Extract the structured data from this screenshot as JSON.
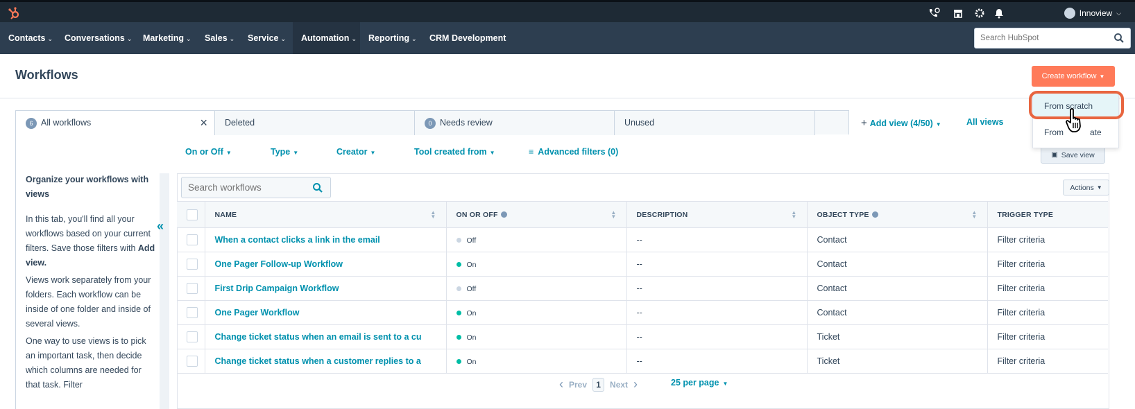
{
  "topbar": {
    "account_name": "Innoview",
    "icons": [
      "hubspot-logo-icon",
      "phone-icon",
      "marketplace-icon",
      "settings-gear-icon",
      "notifications-bell-icon"
    ]
  },
  "nav": {
    "items": [
      {
        "label": "Contacts",
        "has_caret": true
      },
      {
        "label": "Conversations",
        "has_caret": true
      },
      {
        "label": "Marketing",
        "has_caret": true
      },
      {
        "label": "Sales",
        "has_caret": true
      },
      {
        "label": "Service",
        "has_caret": true
      },
      {
        "label": "Automation",
        "has_caret": true,
        "active": true
      },
      {
        "label": "Reporting",
        "has_caret": true
      },
      {
        "label": "CRM Development",
        "has_caret": false
      }
    ],
    "search_placeholder": "Search HubSpot"
  },
  "header": {
    "title": "Workflows",
    "create_button": "Create workflow"
  },
  "create_menu": {
    "options": [
      "From scratch",
      "From template"
    ],
    "visible_options": [
      "From scratch",
      "From"
    ],
    "visible_option_2_tail": "ate"
  },
  "tabs": [
    {
      "label": "All workflows",
      "badge": "6",
      "active": true,
      "closable": true
    },
    {
      "label": "Deleted",
      "badge": null
    },
    {
      "label": "Needs review",
      "badge": "0"
    },
    {
      "label": "Unused",
      "badge": null
    }
  ],
  "tab_actions": {
    "add_view": "Add view (4/50)",
    "all_views": "All views"
  },
  "filters": {
    "on_off": "On or Off",
    "type": "Type",
    "creator": "Creator",
    "tool_created_from": "Tool created from",
    "advanced": "Advanced filters (0)",
    "save_view": "Save view"
  },
  "sidebar": {
    "heading": "Organize your workflows with views",
    "para1_pre": "In this tab, you'll find all your workflows based on your current filters. Save those filters with ",
    "para1_bold": "Add view.",
    "para2": "Views work separately from your folders. Each workflow can be inside of one folder and inside of several views.",
    "para3": "One way to use views is to pick an important task, then decide which columns are needed for that task. Filter"
  },
  "table": {
    "search_placeholder": "Search workflows",
    "actions_label": "Actions",
    "columns": [
      "NAME",
      "ON OR OFF",
      "DESCRIPTION",
      "OBJECT TYPE",
      "TRIGGER TYPE"
    ],
    "rows": [
      {
        "name": "When a contact clicks a link in the email",
        "status": "Off",
        "description": "--",
        "object_type": "Contact",
        "trigger": "Filter criteria"
      },
      {
        "name": "One Pager Follow-up Workflow",
        "status": "On",
        "description": "--",
        "object_type": "Contact",
        "trigger": "Filter criteria"
      },
      {
        "name": "First Drip Campaign Workflow",
        "status": "Off",
        "description": "--",
        "object_type": "Contact",
        "trigger": "Filter criteria"
      },
      {
        "name": "One Pager Workflow",
        "status": "On",
        "description": "--",
        "object_type": "Contact",
        "trigger": "Filter criteria"
      },
      {
        "name": "Change ticket status when an email is sent to a cu",
        "status": "On",
        "description": "--",
        "object_type": "Ticket",
        "trigger": "Filter criteria"
      },
      {
        "name": "Change ticket status when a customer replies to a",
        "status": "On",
        "description": "--",
        "object_type": "Ticket",
        "trigger": "Filter criteria"
      }
    ]
  },
  "pagination": {
    "prev": "Prev",
    "page": "1",
    "next": "Next",
    "per_page": "25 per page"
  },
  "colors": {
    "nav_bg": "#2d3e50",
    "topbar_bg": "#1e2a35",
    "accent_orange": "#ff7a59",
    "link_teal": "#0091ae",
    "status_on": "#00bda5",
    "status_off": "#cbd6e2",
    "highlight_ring": "#e8653f"
  }
}
